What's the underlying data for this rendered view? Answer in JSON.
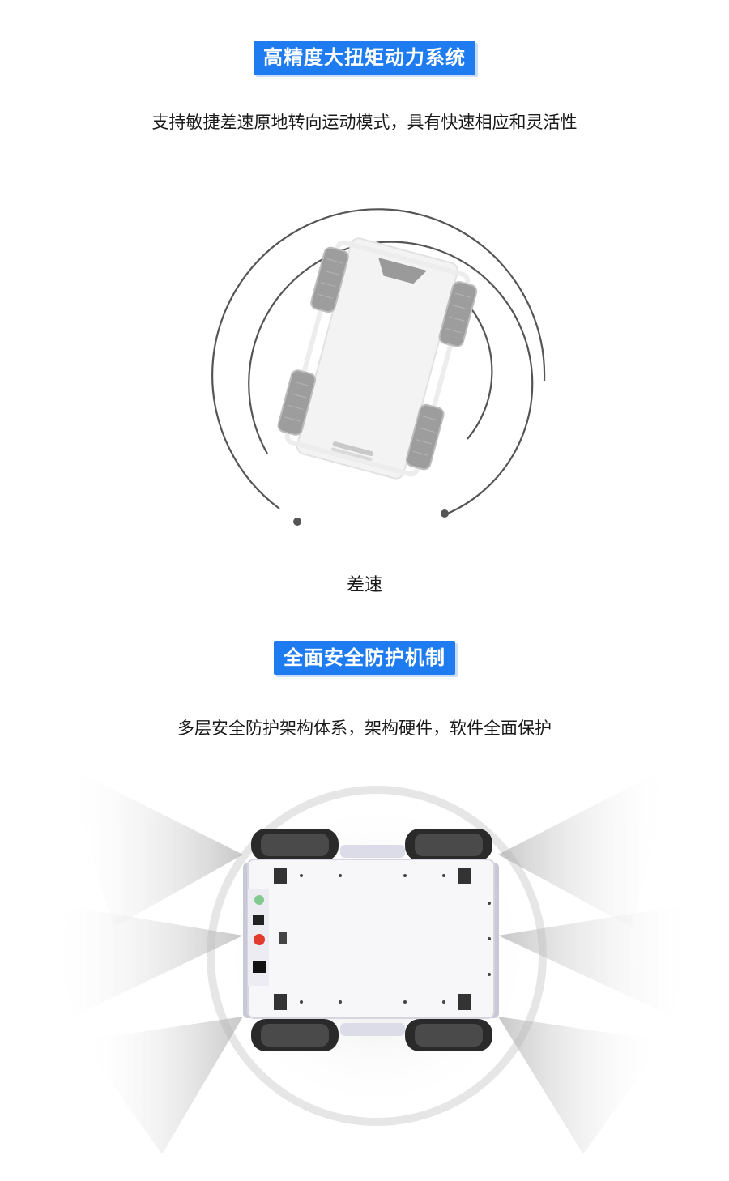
{
  "section1": {
    "title": "高精度大扭矩动力系统",
    "description": "支持敏捷差速原地转向运动模式，具有快速相应和灵活性",
    "caption": "差速"
  },
  "section2": {
    "title": "全面安全防护机制",
    "description": "多层安全防护架构体系，架构硬件，软件全面保护"
  },
  "colors": {
    "accent": "#1e7cf0",
    "badge_shadow": "#c9ddf7"
  }
}
